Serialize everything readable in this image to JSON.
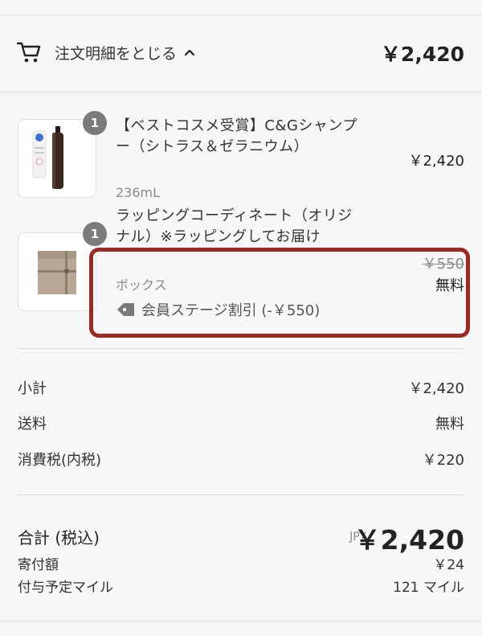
{
  "header": {
    "toggle_label": "注文明細をとじる",
    "total": "￥2,420"
  },
  "items": [
    {
      "quantity": "1",
      "name": "【ベストコスメ受賞】C&Gシャンプー（シトラス＆ゼラニウム）",
      "variant": "236mL",
      "price": "￥2,420"
    },
    {
      "quantity": "1",
      "name": "ラッピングコーディネート（オリジナル）※ラッピングしてお届け",
      "variant": "ボックス",
      "original_price": "￥550",
      "price": "無料",
      "discount": "会員ステージ割引 (-￥550)"
    }
  ],
  "summary": {
    "subtotal_label": "小計",
    "subtotal": "￥2,420",
    "shipping_label": "送料",
    "shipping": "無料",
    "tax_label": "消費税(内税)",
    "tax": "￥220"
  },
  "total": {
    "label": "合計 (税込)",
    "currency": "JPY",
    "amount": "￥2,420",
    "donation_label": "寄付額",
    "donation": "￥24",
    "miles_label": "付与予定マイル",
    "miles": "121 マイル"
  },
  "colors": {
    "highlight_border": "#9a2a22",
    "badge": "#7b7b7b",
    "muted": "#8a8a8a"
  }
}
